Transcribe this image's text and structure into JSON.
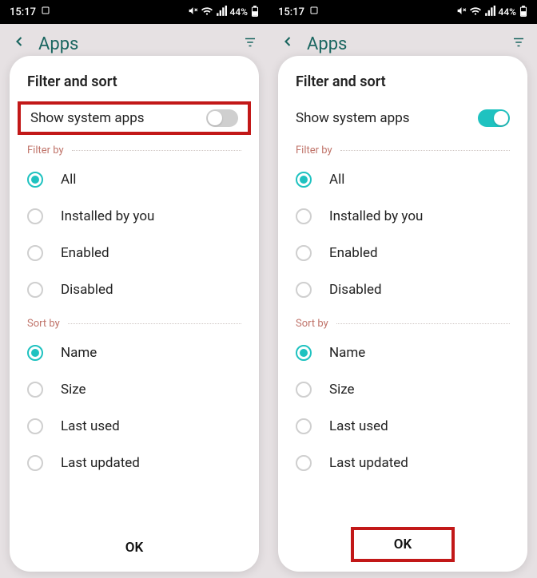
{
  "status": {
    "time": "15:17",
    "battery_text": "44%"
  },
  "bg_header": {
    "title": "Apps"
  },
  "sheet": {
    "title": "Filter and sort",
    "toggle_label": "Show system apps",
    "filter_section": "Filter by",
    "sort_section": "Sort by",
    "filter_options": [
      "All",
      "Installed by you",
      "Enabled",
      "Disabled"
    ],
    "sort_options": [
      "Name",
      "Size",
      "Last used",
      "Last updated"
    ],
    "filter_selected": "All",
    "sort_selected": "Name",
    "ok_label": "OK"
  },
  "left": {
    "toggle_on": false,
    "highlight": "toggle"
  },
  "right": {
    "toggle_on": true,
    "highlight": "ok"
  }
}
